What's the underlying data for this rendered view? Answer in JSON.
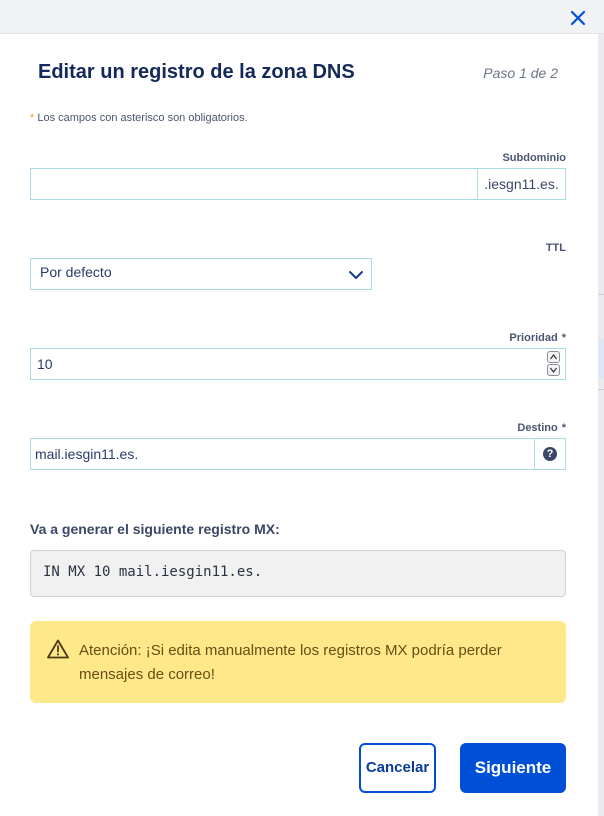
{
  "dialog": {
    "title": "Editar un registro de la zona DNS",
    "step": "Paso 1 de 2",
    "required_marker": "*",
    "required_note": " Los campos con asterisco son obligatorios."
  },
  "fields": {
    "subdomain": {
      "label": "Subdominio",
      "value": "",
      "suffix": ".iesgn11.es."
    },
    "ttl": {
      "label": "TTL",
      "selected": "Por defecto"
    },
    "priority": {
      "label": "Prioridad",
      "required": "*",
      "value": "10"
    },
    "target": {
      "label": "Destino",
      "required": "*",
      "value": "mail.iesgin11.es.",
      "help": "?"
    }
  },
  "preview": {
    "label": "Va a generar el siguiente registro MX:",
    "record": "IN MX 10 mail.iesgin11.es."
  },
  "alert": {
    "text": "Atención: ¡Si edita manualmente los registros MX podría perder mensajes de correo!"
  },
  "buttons": {
    "cancel": "Cancelar",
    "next": "Siguiente"
  },
  "colors": {
    "primary": "#0050d7",
    "title": "#14285a",
    "input_border": "#a9dbe4",
    "alert_bg": "#fde98a",
    "asterisk": "#e8a400"
  },
  "icons": {
    "close": "close-icon",
    "chevron": "chevron-down-icon",
    "spinner_up": "arrow-up-icon",
    "spinner_down": "arrow-down-icon",
    "help": "question-circle-icon",
    "warning": "warning-triangle-icon"
  }
}
